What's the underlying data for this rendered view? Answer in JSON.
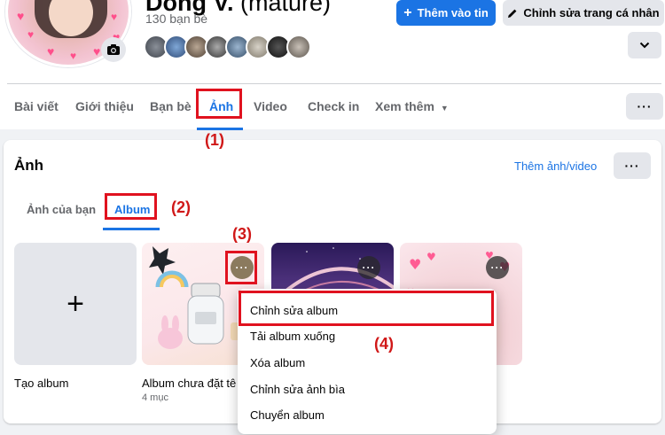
{
  "profile": {
    "name": "Dong V.",
    "nickname": "(mature)",
    "friend_count": "130 bạn bè",
    "add_story_label": "Thêm vào tin",
    "edit_profile_label": "Chỉnh sửa trang cá nhân"
  },
  "nav": {
    "tabs": [
      "Bài viết",
      "Giới thiệu",
      "Bạn bè",
      "Ảnh",
      "Video",
      "Check in",
      "Xem thêm"
    ],
    "active": "Ảnh"
  },
  "photos": {
    "title": "Ảnh",
    "add_link": "Thêm ảnh/video",
    "subtabs": [
      "Ảnh của bạn",
      "Album"
    ],
    "active_subtab": "Album",
    "create_album_label": "Tạo album",
    "albums": [
      {
        "name": "Album chưa đặt tê",
        "count": "4 mục"
      }
    ]
  },
  "menu": {
    "items": [
      "Chỉnh sửa album",
      "Tải album xuống",
      "Xóa album",
      "Chỉnh sửa ảnh bìa",
      "Chuyển album"
    ]
  },
  "annotations": [
    "(1)",
    "(2)",
    "(3)",
    "(4)"
  ],
  "colors": {
    "accent": "#1b74e4",
    "annotation_red": "#e0121f"
  }
}
